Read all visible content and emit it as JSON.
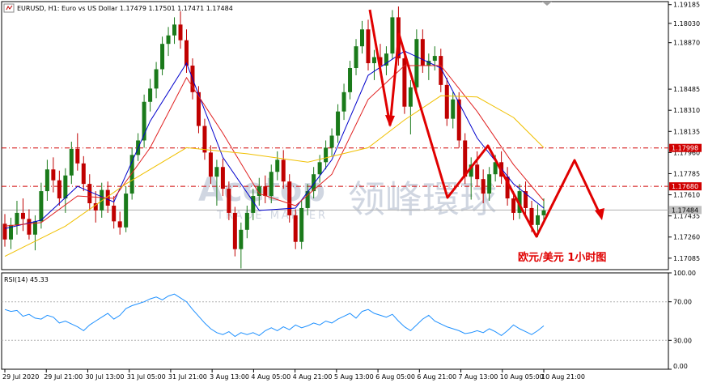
{
  "header": {
    "symbol_line": "EURUSD, H1:  Euro vs US Dollar  1.17479 1.17501 1.17471 1.17484"
  },
  "watermark": {
    "brand": "Acetop",
    "cn": "领峰環球",
    "sub": "TRADE MARTER"
  },
  "annotation": {
    "text": "欧元/美元  1小时图"
  },
  "colors": {
    "bull": "#1a7a1a",
    "bear": "#c00000",
    "ma_fast": "#0000cc",
    "ma_mid": "#e02020",
    "ma_slow": "#f0c000",
    "rsi": "#1e90ff",
    "level": "#d00000",
    "arrow": "#e00000"
  },
  "chart_data": [
    {
      "type": "candlestick",
      "symbol": "EURUSD",
      "timeframe": "H1",
      "description": "Euro vs US Dollar",
      "ohlc_last": {
        "open": 1.17479,
        "high": 1.17501,
        "low": 1.17471,
        "close": 1.17484
      },
      "ylim": [
        1.1699,
        1.1921
      ],
      "y_ticks": [
        "1.19185",
        "1.18030",
        "1.18870",
        "1.18485",
        "1.18310",
        "1.18135",
        "1.17960",
        "1.17785",
        "1.17610",
        "1.17435",
        "1.17260",
        "1.17085"
      ],
      "y_tick_values": [
        1.19185,
        1.1903,
        1.1887,
        1.18485,
        1.1831,
        1.18135,
        1.1796,
        1.17785,
        1.1761,
        1.17435,
        1.1726,
        1.17085
      ],
      "x_ticks": [
        "29 Jul 2020",
        "29 Jul 21:00",
        "30 Jul 13:00",
        "31 Jul 05:00",
        "31 Jul 21:00",
        "3 Aug 13:00",
        "4 Aug 05:00",
        "4 Aug 21:00",
        "5 Aug 13:00",
        "6 Aug 05:00",
        "6 Aug 21:00",
        "7 Aug 13:00",
        "10 Aug 05:00",
        "10 Aug 21:00"
      ],
      "price_levels": [
        {
          "label": "1.17998",
          "value": 1.17998
        },
        {
          "label": "1.17680",
          "value": 1.1768
        }
      ],
      "current_price": {
        "label": "1.17484",
        "value": 1.17484
      },
      "bars": [
        [
          1.1737,
          1.1745,
          1.1718,
          1.1724
        ],
        [
          1.1724,
          1.1742,
          1.1716,
          1.1736
        ],
        [
          1.1736,
          1.1756,
          1.1728,
          1.1746
        ],
        [
          1.1746,
          1.1758,
          1.1731,
          1.1741
        ],
        [
          1.1741,
          1.1749,
          1.1724,
          1.1728
        ],
        [
          1.1728,
          1.1744,
          1.1715,
          1.1739
        ],
        [
          1.1739,
          1.1771,
          1.1733,
          1.1764
        ],
        [
          1.1764,
          1.179,
          1.1756,
          1.1782
        ],
        [
          1.1782,
          1.1792,
          1.1763,
          1.1773
        ],
        [
          1.1773,
          1.1781,
          1.1752,
          1.1758
        ],
        [
          1.1758,
          1.1783,
          1.1746,
          1.1777
        ],
        [
          1.1777,
          1.1805,
          1.177,
          1.1799
        ],
        [
          1.1799,
          1.1812,
          1.1781,
          1.1787
        ],
        [
          1.1787,
          1.1793,
          1.1764,
          1.177
        ],
        [
          1.177,
          1.1778,
          1.1748,
          1.1754
        ],
        [
          1.1754,
          1.1764,
          1.1738,
          1.1748
        ],
        [
          1.1748,
          1.1771,
          1.1742,
          1.1765
        ],
        [
          1.1765,
          1.1772,
          1.1746,
          1.1752
        ],
        [
          1.1752,
          1.176,
          1.1733,
          1.1739
        ],
        [
          1.1739,
          1.1747,
          1.1728,
          1.1734
        ],
        [
          1.1734,
          1.1768,
          1.173,
          1.1762
        ],
        [
          1.1762,
          1.18,
          1.1757,
          1.1794
        ],
        [
          1.1794,
          1.1812,
          1.1789,
          1.1806
        ],
        [
          1.1806,
          1.1844,
          1.18,
          1.1838
        ],
        [
          1.1838,
          1.1857,
          1.183,
          1.1849
        ],
        [
          1.1849,
          1.1871,
          1.1841,
          1.1865
        ],
        [
          1.1865,
          1.1892,
          1.186,
          1.1886
        ],
        [
          1.1886,
          1.19,
          1.1876,
          1.1893
        ],
        [
          1.1893,
          1.1908,
          1.1886,
          1.1902
        ],
        [
          1.1902,
          1.1913,
          1.1882,
          1.1889
        ],
        [
          1.1889,
          1.1898,
          1.1862,
          1.1868
        ],
        [
          1.1868,
          1.1874,
          1.184,
          1.1846
        ],
        [
          1.1846,
          1.1851,
          1.1812,
          1.1818
        ],
        [
          1.1818,
          1.1824,
          1.179,
          1.1796
        ],
        [
          1.1796,
          1.1802,
          1.177,
          1.1776
        ],
        [
          1.1776,
          1.179,
          1.1752,
          1.1784
        ],
        [
          1.1784,
          1.1791,
          1.176,
          1.1766
        ],
        [
          1.1766,
          1.1772,
          1.174,
          1.1746
        ],
        [
          1.1746,
          1.1751,
          1.171,
          1.1716
        ],
        [
          1.1716,
          1.1738,
          1.17,
          1.1732
        ],
        [
          1.1732,
          1.1752,
          1.1725,
          1.1746
        ],
        [
          1.1746,
          1.1766,
          1.174,
          1.176
        ],
        [
          1.176,
          1.1775,
          1.1752,
          1.1768
        ],
        [
          1.1768,
          1.1777,
          1.1754,
          1.176
        ],
        [
          1.176,
          1.1786,
          1.1754,
          1.178
        ],
        [
          1.178,
          1.1797,
          1.1773,
          1.179
        ],
        [
          1.179,
          1.1798,
          1.1766,
          1.1772
        ],
        [
          1.1772,
          1.1778,
          1.1738,
          1.1744
        ],
        [
          1.1744,
          1.1749,
          1.1716,
          1.1722
        ],
        [
          1.1722,
          1.1756,
          1.1716,
          1.175
        ],
        [
          1.175,
          1.177,
          1.1744,
          1.1764
        ],
        [
          1.1764,
          1.1784,
          1.1758,
          1.1778
        ],
        [
          1.1778,
          1.1794,
          1.1771,
          1.1788
        ],
        [
          1.1788,
          1.1806,
          1.1782,
          1.18
        ],
        [
          1.18,
          1.1816,
          1.1793,
          1.181
        ],
        [
          1.181,
          1.1836,
          1.1804,
          1.183
        ],
        [
          1.183,
          1.1853,
          1.1823,
          1.1846
        ],
        [
          1.1846,
          1.1872,
          1.184,
          1.1866
        ],
        [
          1.1866,
          1.189,
          1.186,
          1.1884
        ],
        [
          1.1884,
          1.1905,
          1.1878,
          1.1898
        ],
        [
          1.1898,
          1.1906,
          1.1864,
          1.187
        ],
        [
          1.187,
          1.1881,
          1.1856,
          1.1875
        ],
        [
          1.1875,
          1.1886,
          1.1862,
          1.1868
        ],
        [
          1.1868,
          1.1884,
          1.186,
          1.1878
        ],
        [
          1.1878,
          1.1914,
          1.1873,
          1.1908
        ],
        [
          1.1908,
          1.1917,
          1.1868,
          1.1874
        ],
        [
          1.1874,
          1.188,
          1.1828,
          1.1834
        ],
        [
          1.1834,
          1.1856,
          1.1811,
          1.185
        ],
        [
          1.185,
          1.1898,
          1.1845,
          1.189
        ],
        [
          1.189,
          1.1898,
          1.1862,
          1.1868
        ],
        [
          1.1868,
          1.1878,
          1.1856,
          1.1872
        ],
        [
          1.1872,
          1.1884,
          1.1864,
          1.1876
        ],
        [
          1.1876,
          1.1882,
          1.1846,
          1.1852
        ],
        [
          1.1852,
          1.1858,
          1.1818,
          1.1824
        ],
        [
          1.1824,
          1.1846,
          1.1816,
          1.184
        ],
        [
          1.184,
          1.1846,
          1.18,
          1.1806
        ],
        [
          1.1806,
          1.1812,
          1.177,
          1.1776
        ],
        [
          1.1776,
          1.1792,
          1.1757,
          1.1786
        ],
        [
          1.1786,
          1.1797,
          1.1768,
          1.1774
        ],
        [
          1.1774,
          1.1782,
          1.1754,
          1.1762
        ],
        [
          1.1762,
          1.1784,
          1.1756,
          1.1778
        ],
        [
          1.1778,
          1.1794,
          1.1772,
          1.1788
        ],
        [
          1.1788,
          1.1797,
          1.177,
          1.1776
        ],
        [
          1.1776,
          1.1784,
          1.1752,
          1.1758
        ],
        [
          1.1758,
          1.1764,
          1.174,
          1.1746
        ],
        [
          1.1746,
          1.177,
          1.1741,
          1.1764
        ],
        [
          1.1764,
          1.1772,
          1.1744,
          1.175
        ],
        [
          1.175,
          1.1756,
          1.173,
          1.1736
        ],
        [
          1.1736,
          1.1753,
          1.1726,
          1.1744
        ],
        [
          1.1744,
          1.1758,
          1.1738,
          1.1748
        ]
      ],
      "moving_averages": [
        {
          "points": [
            [
              0,
              1.1733
            ],
            [
              6,
              1.174
            ],
            [
              12,
              1.1768
            ],
            [
              18,
              1.1755
            ],
            [
              24,
              1.1822
            ],
            [
              30,
              1.187
            ],
            [
              36,
              1.1792
            ],
            [
              42,
              1.1748
            ],
            [
              48,
              1.175
            ],
            [
              54,
              1.179
            ],
            [
              60,
              1.186
            ],
            [
              66,
              1.188
            ],
            [
              72,
              1.1866
            ],
            [
              78,
              1.1808
            ],
            [
              84,
              1.177
            ],
            [
              89,
              1.175
            ]
          ]
        },
        {
          "points": [
            [
              0,
              1.1735
            ],
            [
              6,
              1.1738
            ],
            [
              12,
              1.176
            ],
            [
              18,
              1.1758
            ],
            [
              24,
              1.18
            ],
            [
              30,
              1.1858
            ],
            [
              36,
              1.1812
            ],
            [
              42,
              1.1762
            ],
            [
              48,
              1.1752
            ],
            [
              54,
              1.1778
            ],
            [
              60,
              1.184
            ],
            [
              66,
              1.1868
            ],
            [
              72,
              1.1868
            ],
            [
              78,
              1.183
            ],
            [
              84,
              1.1786
            ],
            [
              89,
              1.1756
            ]
          ]
        },
        {
          "points": [
            [
              0,
              1.171
            ],
            [
              10,
              1.1735
            ],
            [
              20,
              1.177
            ],
            [
              30,
              1.18
            ],
            [
              40,
              1.1795
            ],
            [
              50,
              1.1788
            ],
            [
              60,
              1.18
            ],
            [
              66,
              1.1823
            ],
            [
              72,
              1.1843
            ],
            [
              78,
              1.1842
            ],
            [
              84,
              1.1825
            ],
            [
              89,
              1.18
            ]
          ]
        }
      ]
    },
    {
      "type": "line",
      "title": "RSI(14) 45.33",
      "name": "RSI(14)",
      "last_value": 45.33,
      "ylim": [
        0,
        100
      ],
      "y_ticks": [
        "100.00",
        "70.00",
        "30.00",
        "0.00"
      ],
      "levels": [
        70,
        30
      ],
      "values": [
        62,
        60,
        61,
        55,
        57,
        53,
        52,
        56,
        54,
        48,
        50,
        47,
        44,
        40,
        46,
        50,
        54,
        58,
        52,
        56,
        63,
        66,
        68,
        70,
        73,
        75,
        72,
        76,
        78,
        74,
        70,
        62,
        55,
        48,
        42,
        38,
        36,
        39,
        34,
        38,
        36,
        38,
        35,
        40,
        43,
        40,
        44,
        41,
        46,
        43,
        45,
        48,
        46,
        50,
        48,
        52,
        55,
        58,
        53,
        60,
        62,
        58,
        56,
        54,
        57,
        50,
        44,
        40,
        46,
        52,
        56,
        50,
        47,
        44,
        42,
        40,
        37,
        38,
        40,
        38,
        42,
        39,
        35,
        40,
        46,
        42,
        39,
        36,
        40,
        45
      ]
    }
  ]
}
